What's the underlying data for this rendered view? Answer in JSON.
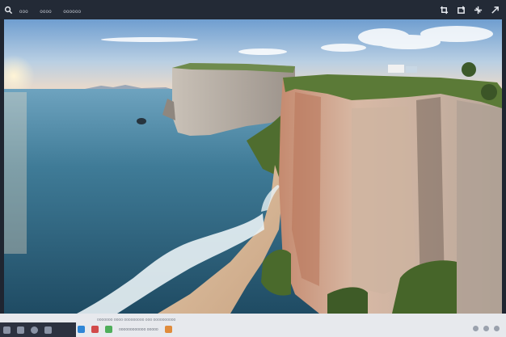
{
  "app": {
    "menu_items": [
      "ooo",
      "oooo",
      "oooooo"
    ]
  },
  "toolbar": {
    "icons": [
      "search-icon",
      "crop-icon",
      "rotate-icon",
      "adjust-icon",
      "share-icon"
    ]
  },
  "image": {
    "description_colors": {
      "sky_top": "#6f9ed0",
      "sky_horizon": "#f6dcc4",
      "sea_deep": "#1f4b63",
      "sea_light": "#5d98b3",
      "cliff": "#c7a58f",
      "grass": "#5b7a37",
      "sand": "#e6c7a4"
    }
  },
  "status": {
    "line_text": "ooooooo  oooo ooooooooo ooo oooooooooo"
  },
  "taskbar": {
    "items_text": "oooooooooooo ooooo"
  }
}
